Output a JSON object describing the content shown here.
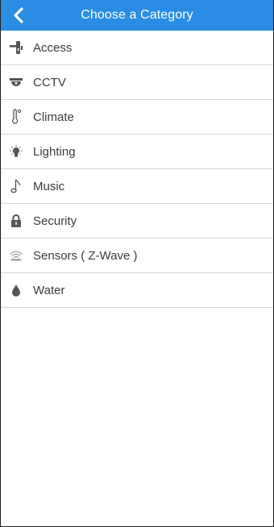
{
  "header": {
    "title": "Choose a Category",
    "back_icon": "chevron-left-icon",
    "background": "#2a8de4"
  },
  "categories": [
    {
      "label": "Access",
      "icon": "door-lock-icon"
    },
    {
      "label": "CCTV",
      "icon": "cctv-camera-icon"
    },
    {
      "label": "Climate",
      "icon": "thermometer-icon"
    },
    {
      "label": "Lighting",
      "icon": "light-bulb-icon"
    },
    {
      "label": "Music",
      "icon": "music-note-icon"
    },
    {
      "label": "Security",
      "icon": "padlock-icon"
    },
    {
      "label": "Sensors ( Z-Wave )",
      "icon": "wireless-signal-icon"
    },
    {
      "label": "Water",
      "icon": "water-drop-icon"
    }
  ],
  "colors": {
    "accent": "#2a8de4",
    "text": "#3b3b3b",
    "icon": "#555555",
    "divider": "#d7d7d7"
  }
}
